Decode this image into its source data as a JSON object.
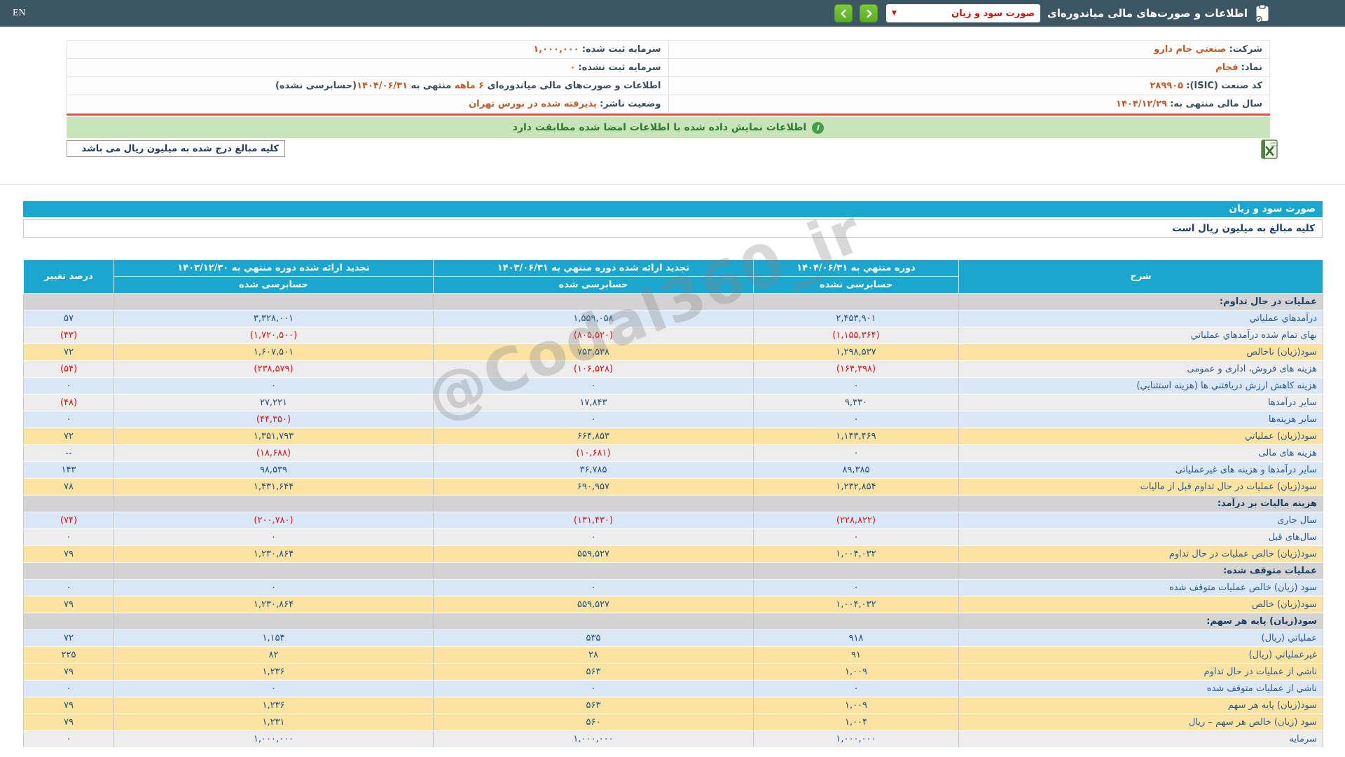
{
  "topbar": {
    "en_label": "EN",
    "title": "اطلاعات و صورت‌های مالی میاندوره‌ای",
    "dropdown_value": "صورت سود و زیان"
  },
  "company_info": {
    "company_label": "شرکت:",
    "company_value": "صنعتي جام دارو",
    "registered_capital_label": "سرمایه ثبت شده:",
    "registered_capital_value": "۱,۰۰۰,۰۰۰",
    "symbol_label": "نماد:",
    "symbol_value": "فجام",
    "unregistered_capital_label": "سرمایه ثبت نشده:",
    "unregistered_capital_value": "۰",
    "isic_label": "کد صنعت (ISIC):",
    "isic_value": "۲۸۹۹۰۵",
    "period_note": {
      "p1": "اطلاعات و صورت‌های مالی میاندوره‌ای ",
      "h1": "۶ ماهه",
      "p2": " منتهی به ",
      "h2": "۱۴۰۴/۰۶/۳۱",
      "p3": "(حسابرسی نشده)"
    },
    "fiscal_year_label": "سال مالی منتهی به:",
    "fiscal_year_value": "۱۴۰۴/۱۲/۲۹",
    "issuer_status_label": "وضعیت ناشر:",
    "issuer_status_value": "پذیرفته شده در بورس تهران"
  },
  "signature_bar": {
    "text": "اطلاعات نمایش داده شده با اطلاعات امضا شده مطابقت دارد",
    "icon": "info-icon"
  },
  "amounts_note": "کلیه مبالغ درج شده به میلیون ریال می باشد",
  "watermark": "@Codal360_ir",
  "colors": {
    "topbar_bg": "#3d5663",
    "accent_teal": "#1aa6cf",
    "nav_button_green": "#5cad1e",
    "signature_bar_bg": "#c8e4b9",
    "red_line": "#e4574b",
    "negative_value": "#e01212",
    "info_value_orange": "#c15b28",
    "row_blue": "#d9e7f6",
    "row_yellow": "#fce3a2",
    "row_gray": "#ededed",
    "section_gray": "#d3d3d3",
    "number_navy": "#1d4e7d"
  },
  "statement": {
    "title": "صورت سود و زیان",
    "unit_note": "کلیه مبالغ به میلیون ریال است",
    "header": {
      "desc": "شرح",
      "col_current": {
        "period": "دوره منتهي به ۱۴۰۴/۰۶/۳۱",
        "audit": "حسابرسی نشده"
      },
      "col_prev_half": {
        "period": "تجدید ارائه شده دوره منتهي به ۱۴۰۳/۰۶/۳۱",
        "audit": "حسابرسی شده"
      },
      "col_prev_year": {
        "period": "تجدید ارائه شده دوره منتهي به ۱۴۰۳/۱۲/۳۰",
        "audit": "حسابرسی شده"
      },
      "pct": "درصد تغییر"
    },
    "rows": [
      {
        "label": "عملیات در حال تداوم:",
        "type": "section"
      },
      {
        "label": "درآمدهاي عملياتي",
        "type": "blue",
        "v1": "۲,۴۵۳,۹۰۱",
        "v2": "۱,۵۵۹,۰۵۸",
        "v3": "۳,۳۲۸,۰۰۱",
        "pct": "۵۷"
      },
      {
        "label": "بهای تمام شده درآمدهاي عملياتي",
        "type": "white",
        "v1": "(۱,۱۵۵,۳۶۴)",
        "v2": "(۸۰۵,۵۲۰)",
        "v3": "(۱,۷۲۰,۵۰۰)",
        "pct": "(۴۳)"
      },
      {
        "label": "سود(زيان) ناخالص",
        "type": "yellow",
        "v1": "۱,۲۹۸,۵۳۷",
        "v2": "۷۵۳,۵۳۸",
        "v3": "۱,۶۰۷,۵۰۱",
        "pct": "۷۲"
      },
      {
        "label": "هزینه های فروش، اداری و عمومی",
        "type": "white",
        "v1": "(۱۶۴,۳۹۸)",
        "v2": "(۱۰۶,۵۲۸)",
        "v3": "(۲۳۸,۵۷۹)",
        "pct": "(۵۴)"
      },
      {
        "label": "هزینه کاهش ارزش دریافتني ها (هزینه استثنایي)",
        "type": "blue",
        "v1": "۰",
        "v2": "۰",
        "v3": "۰",
        "pct": "۰"
      },
      {
        "label": "سایر درآمدها",
        "type": "white",
        "v1": "۹,۳۳۰",
        "v2": "۱۷,۸۴۳",
        "v3": "۲۷,۲۲۱",
        "pct": "(۴۸)"
      },
      {
        "label": "سایر هزینه‌ها",
        "type": "blue",
        "v1": "۰",
        "v2": "۰",
        "v3": "(۴۴,۳۵۰)",
        "pct": "۰"
      },
      {
        "label": "سود(زيان) عملياتي",
        "type": "yellow",
        "v1": "۱,۱۴۳,۴۶۹",
        "v2": "۶۶۴,۸۵۳",
        "v3": "۱,۳۵۱,۷۹۳",
        "pct": "۷۲"
      },
      {
        "label": "هزینه های مالی",
        "type": "white",
        "v1": "۰",
        "v2": "(۱۰,۶۸۱)",
        "v3": "(۱۸,۶۸۸)",
        "pct": "--"
      },
      {
        "label": "سایر درآمدها و هزینه های غیرعملیاتی",
        "type": "blue",
        "v1": "۸۹,۳۸۵",
        "v2": "۳۶,۷۸۵",
        "v3": "۹۸,۵۳۹",
        "pct": "۱۴۳"
      },
      {
        "label": "سود(زيان) عملیات در حال تداوم قبل از مالیات",
        "type": "yellow",
        "v1": "۱,۲۳۲,۸۵۴",
        "v2": "۶۹۰,۹۵۷",
        "v3": "۱,۴۳۱,۶۴۴",
        "pct": "۷۸"
      },
      {
        "label": "هزينه ماليات بر درآمد:",
        "type": "section"
      },
      {
        "label": "سال جاری",
        "type": "blue",
        "v1": "(۲۲۸,۸۲۲)",
        "v2": "(۱۳۱,۴۳۰)",
        "v3": "(۲۰۰,۷۸۰)",
        "pct": "(۷۴)"
      },
      {
        "label": "سال‌های قبل",
        "type": "white",
        "v1": "۰",
        "v2": "۰",
        "v3": "۰",
        "pct": "۰"
      },
      {
        "label": "سود(زيان) خالص عملیات در حال تداوم",
        "type": "yellow",
        "v1": "۱,۰۰۴,۰۳۲",
        "v2": "۵۵۹,۵۲۷",
        "v3": "۱,۲۳۰,۸۶۴",
        "pct": "۷۹"
      },
      {
        "label": "عملیات متوقف شده:",
        "type": "section"
      },
      {
        "label": "سود (زیان) خالص عملیات متوقف شده",
        "type": "blue",
        "v1": "۰",
        "v2": "۰",
        "v3": "۰",
        "pct": "۰"
      },
      {
        "label": "سود(زيان) خالص",
        "type": "yellow",
        "v1": "۱,۰۰۴,۰۳۲",
        "v2": "۵۵۹,۵۲۷",
        "v3": "۱,۲۳۰,۸۶۴",
        "pct": "۷۹"
      },
      {
        "label": "سود(زيان) پایه هر سهم:",
        "type": "section"
      },
      {
        "label": "عملياتي (ريال)",
        "type": "blue",
        "v1": "۹۱۸",
        "v2": "۵۳۵",
        "v3": "۱,۱۵۴",
        "pct": "۷۲"
      },
      {
        "label": "غیرعملیاتي (ریال)",
        "type": "yellow",
        "v1": "۹۱",
        "v2": "۲۸",
        "v3": "۸۲",
        "pct": "۲۲۵"
      },
      {
        "label": "ناشي از عملیات در حال تداوم",
        "type": "yellow",
        "v1": "۱,۰۰۹",
        "v2": "۵۶۳",
        "v3": "۱,۲۳۶",
        "pct": "۷۹"
      },
      {
        "label": "ناشي از عملیات متوقف شده",
        "type": "blue",
        "v1": "۰",
        "v2": "۰",
        "v3": "۰",
        "pct": "۰"
      },
      {
        "label": "سود(زيان) پایه هر سهم",
        "type": "yellow",
        "v1": "۱,۰۰۹",
        "v2": "۵۶۳",
        "v3": "۱,۲۳۶",
        "pct": "۷۹"
      },
      {
        "label": "سود (زیان) خالص هر سهم – ریال",
        "type": "yellow",
        "v1": "۱,۰۰۴",
        "v2": "۵۶۰",
        "v3": "۱,۲۳۱",
        "pct": "۷۹"
      },
      {
        "label": "سرمایه",
        "type": "white",
        "v1": "۱,۰۰۰,۰۰۰",
        "v2": "۱,۰۰۰,۰۰۰",
        "v3": "۱,۰۰۰,۰۰۰",
        "pct": "۰"
      }
    ]
  }
}
